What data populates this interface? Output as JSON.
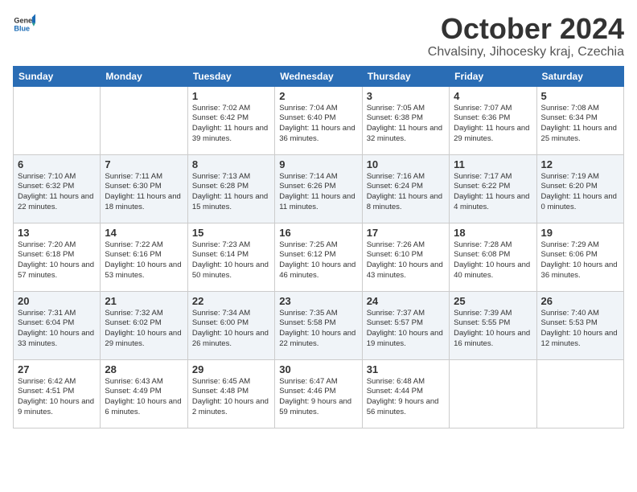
{
  "header": {
    "logo_general": "General",
    "logo_blue": "Blue",
    "month": "October 2024",
    "location": "Chvalsiny, Jihocesky kraj, Czechia"
  },
  "weekdays": [
    "Sunday",
    "Monday",
    "Tuesday",
    "Wednesday",
    "Thursday",
    "Friday",
    "Saturday"
  ],
  "weeks": [
    [
      {
        "day": "",
        "info": ""
      },
      {
        "day": "",
        "info": ""
      },
      {
        "day": "1",
        "info": "Sunrise: 7:02 AM\nSunset: 6:42 PM\nDaylight: 11 hours and 39 minutes."
      },
      {
        "day": "2",
        "info": "Sunrise: 7:04 AM\nSunset: 6:40 PM\nDaylight: 11 hours and 36 minutes."
      },
      {
        "day": "3",
        "info": "Sunrise: 7:05 AM\nSunset: 6:38 PM\nDaylight: 11 hours and 32 minutes."
      },
      {
        "day": "4",
        "info": "Sunrise: 7:07 AM\nSunset: 6:36 PM\nDaylight: 11 hours and 29 minutes."
      },
      {
        "day": "5",
        "info": "Sunrise: 7:08 AM\nSunset: 6:34 PM\nDaylight: 11 hours and 25 minutes."
      }
    ],
    [
      {
        "day": "6",
        "info": "Sunrise: 7:10 AM\nSunset: 6:32 PM\nDaylight: 11 hours and 22 minutes."
      },
      {
        "day": "7",
        "info": "Sunrise: 7:11 AM\nSunset: 6:30 PM\nDaylight: 11 hours and 18 minutes."
      },
      {
        "day": "8",
        "info": "Sunrise: 7:13 AM\nSunset: 6:28 PM\nDaylight: 11 hours and 15 minutes."
      },
      {
        "day": "9",
        "info": "Sunrise: 7:14 AM\nSunset: 6:26 PM\nDaylight: 11 hours and 11 minutes."
      },
      {
        "day": "10",
        "info": "Sunrise: 7:16 AM\nSunset: 6:24 PM\nDaylight: 11 hours and 8 minutes."
      },
      {
        "day": "11",
        "info": "Sunrise: 7:17 AM\nSunset: 6:22 PM\nDaylight: 11 hours and 4 minutes."
      },
      {
        "day": "12",
        "info": "Sunrise: 7:19 AM\nSunset: 6:20 PM\nDaylight: 11 hours and 0 minutes."
      }
    ],
    [
      {
        "day": "13",
        "info": "Sunrise: 7:20 AM\nSunset: 6:18 PM\nDaylight: 10 hours and 57 minutes."
      },
      {
        "day": "14",
        "info": "Sunrise: 7:22 AM\nSunset: 6:16 PM\nDaylight: 10 hours and 53 minutes."
      },
      {
        "day": "15",
        "info": "Sunrise: 7:23 AM\nSunset: 6:14 PM\nDaylight: 10 hours and 50 minutes."
      },
      {
        "day": "16",
        "info": "Sunrise: 7:25 AM\nSunset: 6:12 PM\nDaylight: 10 hours and 46 minutes."
      },
      {
        "day": "17",
        "info": "Sunrise: 7:26 AM\nSunset: 6:10 PM\nDaylight: 10 hours and 43 minutes."
      },
      {
        "day": "18",
        "info": "Sunrise: 7:28 AM\nSunset: 6:08 PM\nDaylight: 10 hours and 40 minutes."
      },
      {
        "day": "19",
        "info": "Sunrise: 7:29 AM\nSunset: 6:06 PM\nDaylight: 10 hours and 36 minutes."
      }
    ],
    [
      {
        "day": "20",
        "info": "Sunrise: 7:31 AM\nSunset: 6:04 PM\nDaylight: 10 hours and 33 minutes."
      },
      {
        "day": "21",
        "info": "Sunrise: 7:32 AM\nSunset: 6:02 PM\nDaylight: 10 hours and 29 minutes."
      },
      {
        "day": "22",
        "info": "Sunrise: 7:34 AM\nSunset: 6:00 PM\nDaylight: 10 hours and 26 minutes."
      },
      {
        "day": "23",
        "info": "Sunrise: 7:35 AM\nSunset: 5:58 PM\nDaylight: 10 hours and 22 minutes."
      },
      {
        "day": "24",
        "info": "Sunrise: 7:37 AM\nSunset: 5:57 PM\nDaylight: 10 hours and 19 minutes."
      },
      {
        "day": "25",
        "info": "Sunrise: 7:39 AM\nSunset: 5:55 PM\nDaylight: 10 hours and 16 minutes."
      },
      {
        "day": "26",
        "info": "Sunrise: 7:40 AM\nSunset: 5:53 PM\nDaylight: 10 hours and 12 minutes."
      }
    ],
    [
      {
        "day": "27",
        "info": "Sunrise: 6:42 AM\nSunset: 4:51 PM\nDaylight: 10 hours and 9 minutes."
      },
      {
        "day": "28",
        "info": "Sunrise: 6:43 AM\nSunset: 4:49 PM\nDaylight: 10 hours and 6 minutes."
      },
      {
        "day": "29",
        "info": "Sunrise: 6:45 AM\nSunset: 4:48 PM\nDaylight: 10 hours and 2 minutes."
      },
      {
        "day": "30",
        "info": "Sunrise: 6:47 AM\nSunset: 4:46 PM\nDaylight: 9 hours and 59 minutes."
      },
      {
        "day": "31",
        "info": "Sunrise: 6:48 AM\nSunset: 4:44 PM\nDaylight: 9 hours and 56 minutes."
      },
      {
        "day": "",
        "info": ""
      },
      {
        "day": "",
        "info": ""
      }
    ]
  ]
}
